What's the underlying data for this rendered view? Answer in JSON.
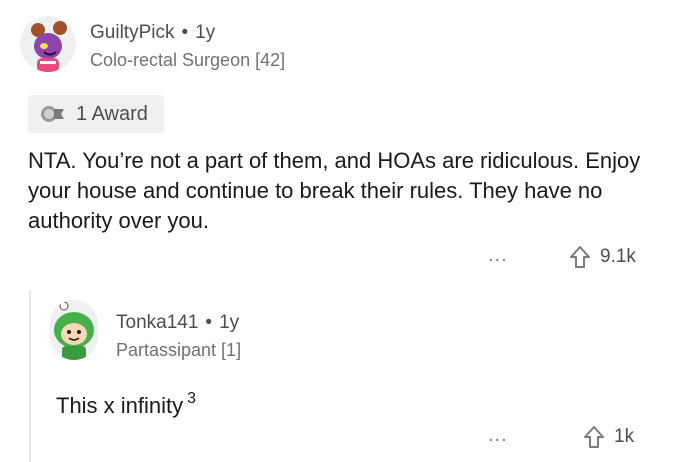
{
  "parent": {
    "username": "GuiltyPick",
    "age": "1y",
    "flair": "Colo-rectal Surgeon [42]",
    "award_label": "1 Award",
    "body": "NTA. You’re not a part of them, and HOAs are ridiculous. Enjoy your house and continue to break their rules. They have no authority over you.",
    "more_label": "...",
    "votes": "9.1k"
  },
  "reply": {
    "username": "Tonka141",
    "age": "1y",
    "flair": "Partassipant [1]",
    "body": "This x infinity",
    "superscript": "3",
    "more_label": "...",
    "votes": "1k"
  },
  "separator": "•",
  "icons": {
    "parent_avatar": "purple-snoo-avatar",
    "award": "award-icon",
    "upvote": "upvote-arrow-icon",
    "reply_avatar": "green-hooded-snoo-avatar"
  },
  "colors": {
    "text": "#1a1a1b",
    "meta": "#4d4d4f",
    "award_bg": "#f0f0f0"
  }
}
